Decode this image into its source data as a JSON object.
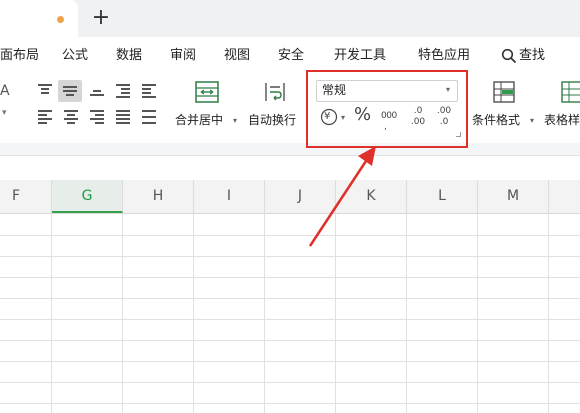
{
  "tabs": {
    "new_tab": "+"
  },
  "menu": [
    "面布局",
    "公式",
    "数据",
    "审阅",
    "视图",
    "安全",
    "开发工具",
    "特色应用",
    "查找"
  ],
  "ribbon": {
    "merge_center": "合并居中",
    "auto_wrap": "自动换行",
    "number_format": "常规",
    "currency_symbol": "¥",
    "percent_symbol": "%",
    "thousands_symbol": "000",
    "decimal_inc": ".0 .00",
    "decimal_dec": ".00 .0",
    "conditional_format": "条件格式",
    "table_style": "表格样"
  },
  "columns": [
    "F",
    "G",
    "H",
    "I",
    "J",
    "K",
    "L",
    "M"
  ],
  "selected_column": "G",
  "colors": {
    "accent": "#36a24f",
    "highlight": "#e0302a"
  }
}
